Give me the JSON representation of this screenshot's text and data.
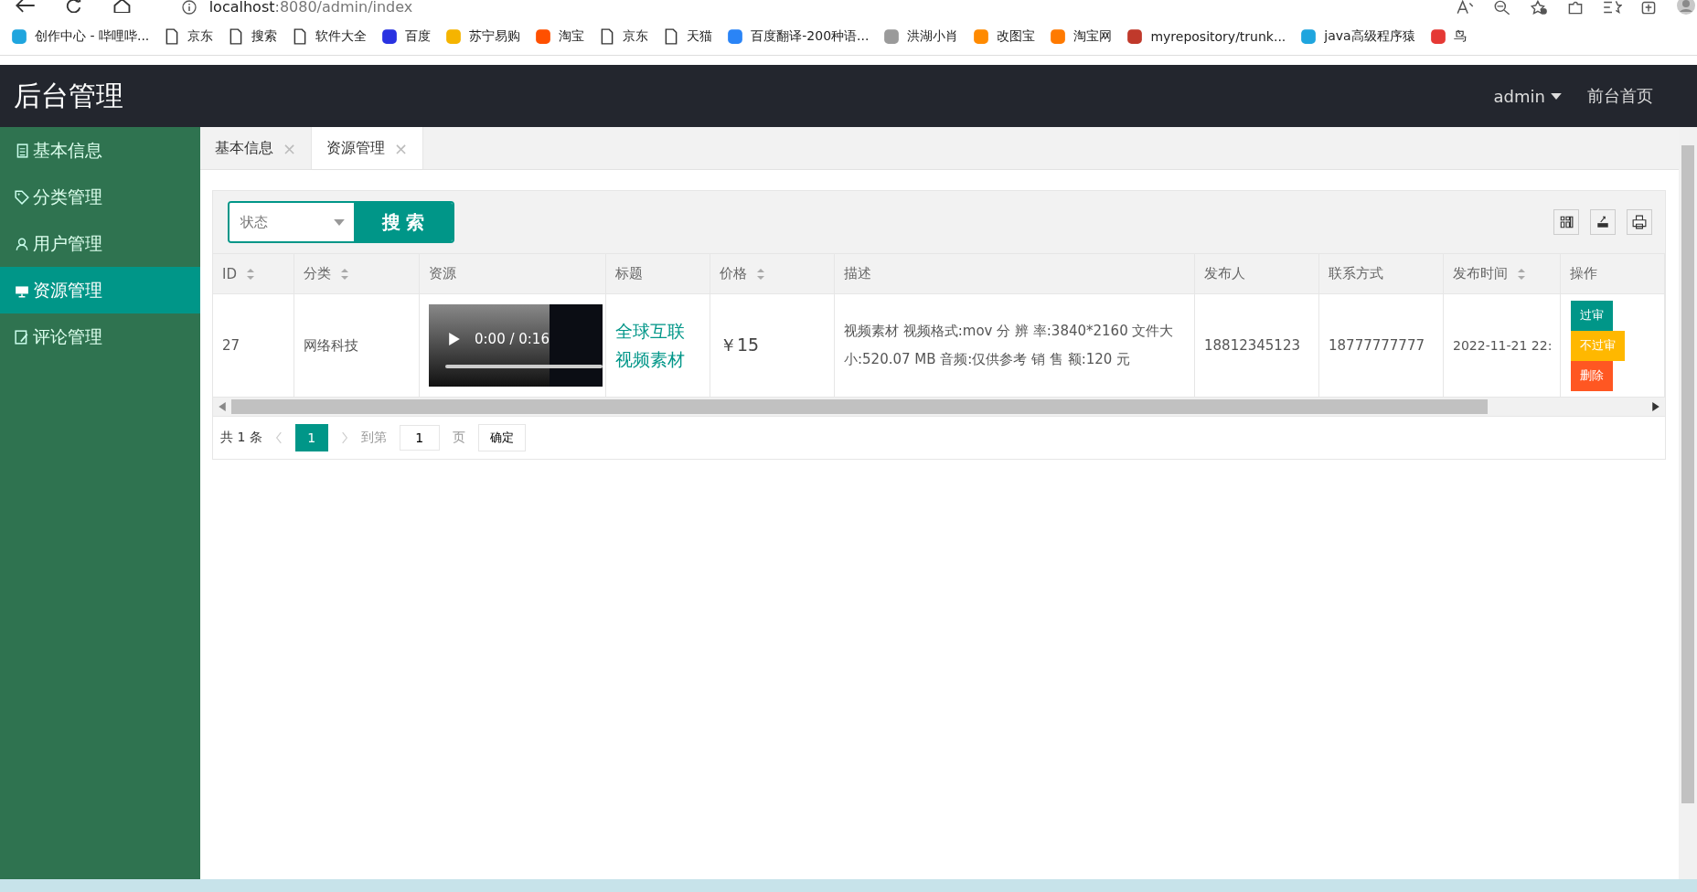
{
  "browser": {
    "url_host": "localhost",
    "url_rest": ":8080/admin/index",
    "bookmarks": [
      {
        "label": "创作中心 - 哔哩哔...",
        "color": "#1fa5de"
      },
      {
        "label": "京东"
      },
      {
        "label": "搜索"
      },
      {
        "label": "软件大全"
      },
      {
        "label": "百度",
        "color": "#2932e1"
      },
      {
        "label": "苏宁易购",
        "color": "#f5b400"
      },
      {
        "label": "淘宝",
        "color": "#ff5000"
      },
      {
        "label": "京东"
      },
      {
        "label": "天猫"
      },
      {
        "label": "百度翻译-200种语...",
        "color": "#2a84f6"
      },
      {
        "label": "洪湖小肖",
        "color": "#9a9a9a"
      },
      {
        "label": "改图宝",
        "color": "#ff8a00"
      },
      {
        "label": "淘宝网",
        "color": "#ff7a00"
      },
      {
        "label": "myrepository/trunk...",
        "color": "#c0392b"
      },
      {
        "label": "java高级程序猿",
        "color": "#1fa5de"
      },
      {
        "label": "鸟",
        "color": "#e53935"
      }
    ]
  },
  "header": {
    "title": "后台管理",
    "user": "admin",
    "home_link": "前台首页"
  },
  "sidebar": {
    "items": [
      {
        "label": "基本信息",
        "selected": false
      },
      {
        "label": "分类管理",
        "selected": false
      },
      {
        "label": "用户管理",
        "selected": false
      },
      {
        "label": "资源管理",
        "selected": true
      },
      {
        "label": "评论管理",
        "selected": false
      }
    ]
  },
  "tabs": [
    {
      "label": "基本信息",
      "close": "×",
      "selected": false
    },
    {
      "label": "资源管理",
      "close": "×",
      "selected": true
    }
  ],
  "filter": {
    "placeholder": "状态",
    "button": "搜 索"
  },
  "table": {
    "columns": [
      {
        "label": "ID",
        "sortable": true
      },
      {
        "label": "分类",
        "sortable": true
      },
      {
        "label": "资源",
        "sortable": false
      },
      {
        "label": "标题",
        "sortable": false
      },
      {
        "label": "价格",
        "sortable": true
      },
      {
        "label": "描述",
        "sortable": false
      },
      {
        "label": "发布人",
        "sortable": false
      },
      {
        "label": "联系方式",
        "sortable": false
      },
      {
        "label": "发布时间",
        "sortable": true
      },
      {
        "label": "操作",
        "sortable": false
      }
    ],
    "rows": [
      {
        "id": "27",
        "category": "网络科技",
        "video_time": "0:00 / 0:16",
        "video_progress": {
          "level": 0
        },
        "title": "全球互联视频素材",
        "price": "￥15",
        "description": "视频素材 视频格式:mov 分 辨 率:3840*2160 文件大小:520.07 MB 音频:仅供参考 销 售 额:120 元",
        "publisher": "18812345123",
        "contact": "18777777777",
        "time": "2022-11-21 22:",
        "actions": [
          {
            "label": "过审",
            "kind": "approve"
          },
          {
            "label": "不过审",
            "kind": "reject"
          },
          {
            "label": "删除",
            "kind": "delete"
          }
        ]
      }
    ]
  },
  "pagination": {
    "total": "共 1 条",
    "pages": [
      {
        "label": "1",
        "selected": true
      }
    ],
    "goto_label": "到第",
    "goto_value": "1",
    "page_unit": "页",
    "confirm": "确定"
  }
}
